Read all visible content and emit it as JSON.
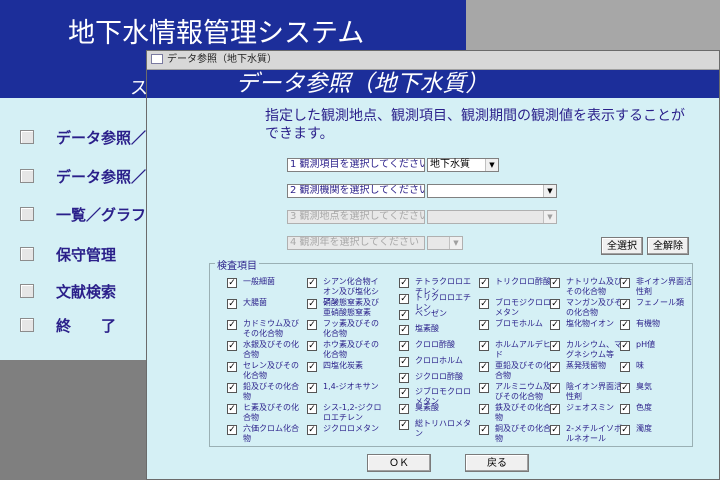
{
  "main_window": {
    "title": "地下水情報管理システム",
    "subtitle_glyph": "ス",
    "menu_items": [
      "データ参照／",
      "データ参照／",
      "一覧／グラフ",
      "保守管理",
      "文献検索",
      "終　　了"
    ]
  },
  "dialog": {
    "caption": "データ参照（地下水質）",
    "title": "データ参照（地下水質）",
    "description": "指定した観測地点、観測項目、観測期間の観測値を表示することができます。",
    "selectors": [
      {
        "label": "1 観測項目を選択してください",
        "value": "地下水質",
        "enabled": true
      },
      {
        "label": "2 観測機関を選択してください",
        "value": "",
        "enabled": true
      },
      {
        "label": "3 観測地点を選択してください",
        "value": "",
        "enabled": false
      },
      {
        "label": "4 観測年を選択してください",
        "value": "",
        "enabled": false
      }
    ],
    "select_all_label": "全選択",
    "clear_all_label": "全解除",
    "group_title": "検査項目",
    "check_mark": "✓",
    "columns": [
      [
        "一般細菌",
        "大腸菌",
        "カドミウム及びその化合物",
        "水銀及びその化合物",
        "セレン及びその化合物",
        "鉛及びその化合物",
        "ヒ素及びその化合物",
        "六価クロム化合物"
      ],
      [
        "シアン化合物イオン及び塩化シアン",
        "硝酸態窒素及び亜硝酸態窒素",
        "フッ素及びその化合物",
        "ホウ素及びその化合物",
        "四塩化炭素",
        "1,4-ジオキサン",
        "シス-1,2-ジクロロエチレン",
        "ジクロロメタン"
      ],
      [
        "テトラクロロエチレン",
        "トリクロロエチレン",
        "ベンゼン",
        "塩素酸",
        "クロロ酢酸",
        "クロロホルム",
        "ジクロロ酢酸",
        "ジブロモクロロメタン",
        "臭素酸",
        "総トリハロメタン"
      ],
      [
        "トリクロロ酢酸",
        "ブロモジクロロメタン",
        "ブロモホルム",
        "ホルムアルデヒド",
        "亜鉛及びその化合物",
        "アルミニウム及びその化合物",
        "鉄及びその化合物",
        "銅及びその化合物"
      ],
      [
        "ナトリウム及びその化合物",
        "マンガン及びその化合物",
        "塩化物イオン",
        "カルシウム、マグネシウム等",
        "蒸発残留物",
        "陰イオン界面活性剤",
        "ジェオスミン",
        "2-メチルイソボルネオール"
      ],
      [
        "非イオン界面活性剤",
        "フェノール類",
        "有機物",
        "pH値",
        "味",
        "臭気",
        "色度",
        "濁度"
      ]
    ],
    "ok_label": "ＯＫ",
    "back_label": "戻る"
  }
}
